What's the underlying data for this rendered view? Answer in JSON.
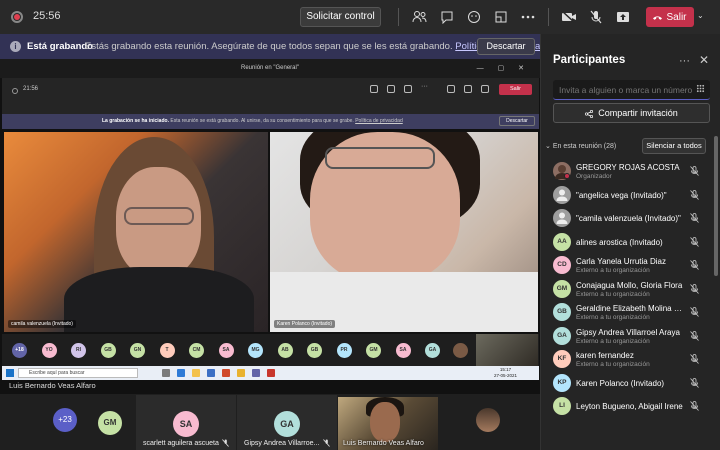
{
  "topbar": {
    "timer": "25:56",
    "control_button": "Solicitar control",
    "leave_label": "Salir"
  },
  "banner": {
    "title": "Está grabando",
    "message": "Estás grabando esta reunión. Asegúrate de que todos sepan que se les está grabando.",
    "link": "Política de privacidad",
    "dismiss": "Descartar"
  },
  "shared_screen": {
    "window_title": "Reunión en \"General\"",
    "timer": "21:56",
    "leave_label": "Salir",
    "banner_title": "La grabación se ha iniciado.",
    "banner_message": "Esta reunión se está grabando. Al unirse, da su consentimiento para que se grabe.",
    "banner_link": "Política de privacidad",
    "banner_dismiss": "Descartar",
    "video_left_label": "camila valenzuela (Invitado)",
    "video_right_label": "Karen Polanco (Invitado)",
    "mini_avatars": [
      "+18",
      "YO",
      "RI",
      "GB",
      "GN",
      "T",
      "CM",
      "SA",
      "MG",
      "AB",
      "GB",
      "PR",
      "GM",
      "SA",
      "GA"
    ],
    "taskbar_search": "Escribe aquí para buscar",
    "taskbar_time": "15:17",
    "taskbar_date": "27-05-2021",
    "presenter": "Luis Bernardo Veas Alfaro"
  },
  "gallery": {
    "more": "+23",
    "tiles": [
      {
        "initials": "GM",
        "name": ""
      },
      {
        "initials": "SA",
        "name": "scarlett aguilera ascueta"
      },
      {
        "initials": "GA",
        "name": "Gipsy Andrea Villarroe..."
      },
      {
        "initials": "",
        "name": "Luis Bernardo Veas Alfaro"
      }
    ]
  },
  "panel": {
    "title": "Participantes",
    "invite_placeholder": "Invita a alguien o marca un número",
    "share_button": "Compartir invitación",
    "section_label": "En esta reunión (28)",
    "mute_all": "Silenciar a todos",
    "participants": [
      {
        "initials": "",
        "name": "GREGORY ROJAS ACOSTA",
        "sub": "Organizador",
        "color": "#8d6e63"
      },
      {
        "initials": "",
        "name": "\"angelica vega (Invitado)\"",
        "sub": "",
        "color": "#9e9e9e"
      },
      {
        "initials": "",
        "name": "\"camila valenzuela (Invitado)\"",
        "sub": "",
        "color": "#9e9e9e"
      },
      {
        "initials": "AA",
        "name": "alines arostica (Invitado)",
        "sub": "",
        "color": "#c5e1a5"
      },
      {
        "initials": "CD",
        "name": "Carla Yanela Urrutia Diaz",
        "sub": "Externo a tu organización",
        "color": "#f8bbd0"
      },
      {
        "initials": "GM",
        "name": "Conajagua Mollo, Gloria Flora",
        "sub": "Externo a tu organización",
        "color": "#c5e1a5"
      },
      {
        "initials": "GB",
        "name": "Geraldine Elizabeth Molina Br...",
        "sub": "Externo a tu organización",
        "color": "#b2dfdb"
      },
      {
        "initials": "GA",
        "name": "Gipsy Andrea Villarroel Araya",
        "sub": "Externo a tu organización",
        "color": "#b2dfdb"
      },
      {
        "initials": "KF",
        "name": "karen fernandez",
        "sub": "Externo a tu organización",
        "color": "#ffccbc"
      },
      {
        "initials": "KP",
        "name": "Karen Polanco (Invitado)",
        "sub": "",
        "color": "#b3e5fc"
      },
      {
        "initials": "LI",
        "name": "Leyton Bugueno, Abigail Irene",
        "sub": "",
        "color": "#c5e1a5"
      }
    ]
  },
  "colors": {
    "accent": "#5b5fc7",
    "leave": "#c4314b",
    "banner_bg": "#323255"
  }
}
